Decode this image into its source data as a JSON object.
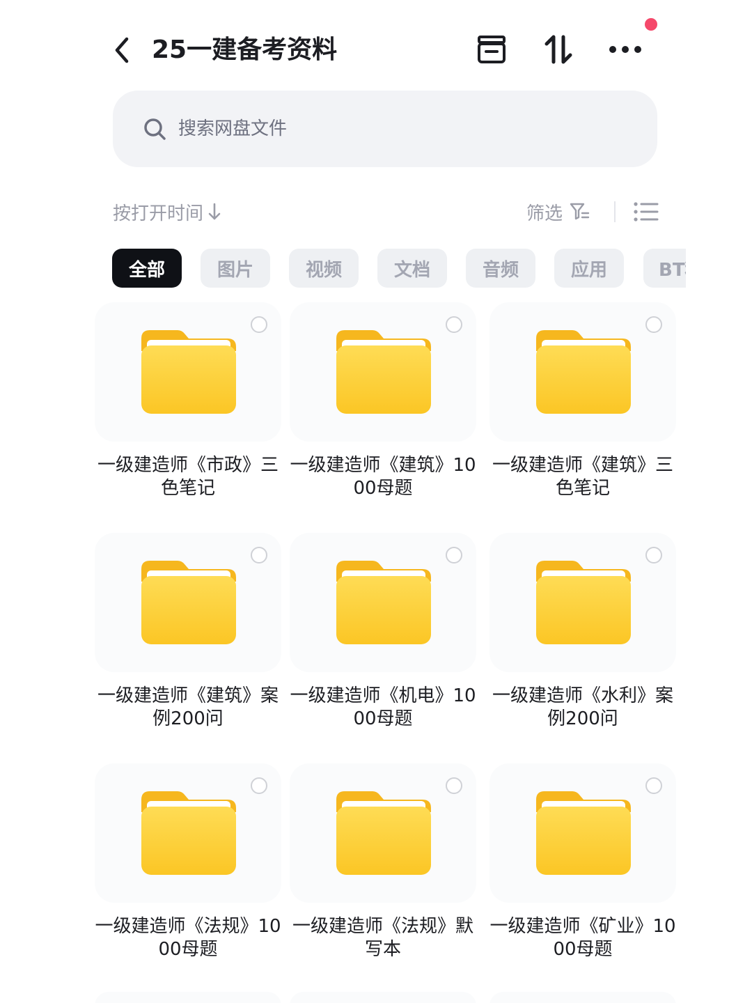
{
  "header": {
    "title": "25一建备考资料",
    "icons": {
      "back": "chevron-left-icon",
      "archive": "archive-box-icon",
      "sort": "swap-vertical-icon",
      "more": "more-dots-icon"
    },
    "notification_color": "#f5486a"
  },
  "search": {
    "placeholder": "搜索网盘文件",
    "value": ""
  },
  "toolbar": {
    "sort_label": "按打开时间",
    "filter_label": "筛选"
  },
  "categories": {
    "selected": "全部",
    "items": [
      "全部",
      "图片",
      "视频",
      "文档",
      "音频",
      "应用",
      "BT种子"
    ]
  },
  "folders": [
    {
      "name": "一级建造师《市政》三色笔记"
    },
    {
      "name": "一级建造师《建筑》1000母题"
    },
    {
      "name": "一级建造师《建筑》三色笔记"
    },
    {
      "name": "一级建造师《建筑》案例200问"
    },
    {
      "name": "一级建造师《机电》1000母题"
    },
    {
      "name": "一级建造师《水利》案例200问"
    },
    {
      "name": "一级建造师《法规》1000母题"
    },
    {
      "name": "一级建造师《法规》默写本"
    },
    {
      "name": "一级建造师《矿业》1000母题"
    }
  ],
  "colors": {
    "folder_yellow": "#fdd43a",
    "chip_active": "#0f1116",
    "chip_inactive": "#eef0f3"
  }
}
